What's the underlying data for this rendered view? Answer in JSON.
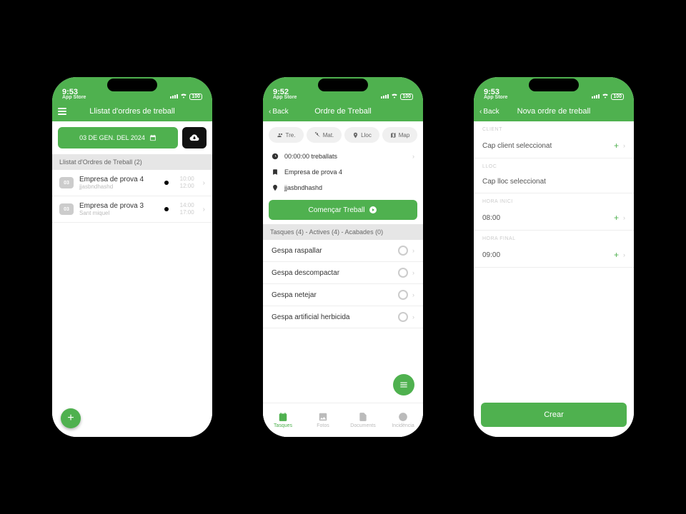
{
  "colors": {
    "primary": "#4fb14f"
  },
  "statusbar": {
    "app_store": "App Store",
    "battery": "100"
  },
  "phone1": {
    "time": "9:53",
    "title": "Llistat d'ordres de treball",
    "date_button": "03 DE GEN. DEL 2024",
    "section_header": "Llistat d'Ordres de Treball (2)",
    "orders": [
      {
        "badge": "03",
        "title": "Empresa de prova 4",
        "sub": "jjasbndhashd",
        "t1": "10:00",
        "t2": "12:00"
      },
      {
        "badge": "03",
        "title": "Empresa de prova 3",
        "sub": "Sant miquel",
        "t1": "14:00",
        "t2": "17:00"
      }
    ]
  },
  "phone2": {
    "time": "9:52",
    "back": "Back",
    "title": "Ordre de Treball",
    "segments": [
      {
        "label": "Tre."
      },
      {
        "label": "Mat."
      },
      {
        "label": "Lloc"
      },
      {
        "label": "Map"
      }
    ],
    "info": {
      "time_worked": "00:00:00 treballats",
      "company": "Empresa de prova 4",
      "location": "jjasbndhashd"
    },
    "start_button": "Començar Treball",
    "tasks_header": "Tasques (4) - Actives (4) - Acabades (0)",
    "tasks": [
      "Gespa raspallar",
      "Gespa descompactar",
      "Gespa netejar",
      "Gespa artificial herbicida"
    ],
    "tabs": [
      {
        "label": "Tasques"
      },
      {
        "label": "Fotos"
      },
      {
        "label": "Documents"
      },
      {
        "label": "Incidència"
      }
    ]
  },
  "phone3": {
    "time": "9:53",
    "back": "Back",
    "title": "Nova ordre de treball",
    "labels": {
      "client": "CLIENT",
      "lloc": "LLOC",
      "hora_inici": "HORA INICI",
      "hora_final": "HORA FINAL"
    },
    "fields": {
      "client": "Cap client seleccionat",
      "lloc": "Cap lloc seleccionat",
      "hora_inici": "08:00",
      "hora_final": "09:00"
    },
    "create": "Crear"
  }
}
